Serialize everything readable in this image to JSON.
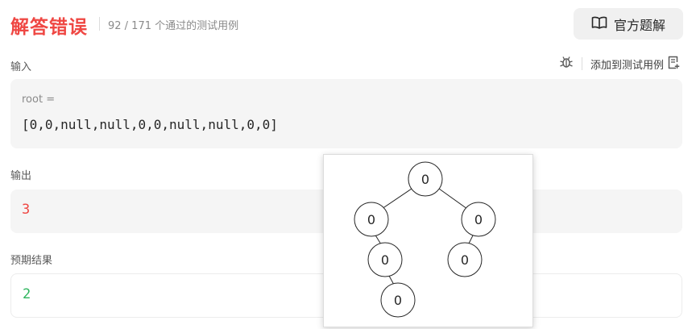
{
  "header": {
    "status": "解答错误",
    "pass_info": "92 / 171 个通过的测试用例",
    "solution_button": "官方题解"
  },
  "input": {
    "label": "输入",
    "var_name": "root =",
    "var_value": "[0,0,null,null,0,0,null,null,0,0]"
  },
  "toolbar": {
    "add_case_label": "添加到测试用例"
  },
  "output": {
    "label": "输出",
    "value": "3"
  },
  "expected": {
    "label": "预期结果",
    "value": "2"
  },
  "tree": {
    "node_labels": [
      "0",
      "0",
      "0",
      "0",
      "0",
      "0"
    ]
  },
  "colors": {
    "error": "#ef4743",
    "success": "#2db55d"
  }
}
